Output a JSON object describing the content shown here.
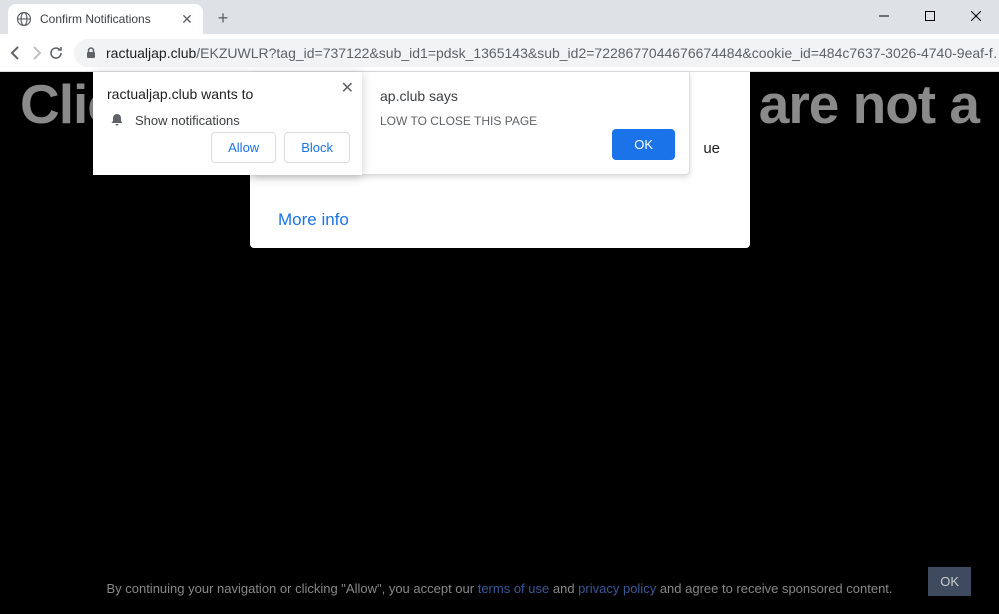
{
  "tab": {
    "title": "Confirm Notifications"
  },
  "url": {
    "domain": "ractualjap.club",
    "path": "/EKZUWLR?tag_id=737122&sub_id1=pdsk_1365143&sub_id2=7228677044676674484&cookie_id=484c7637-3026-4740-9eaf-f…"
  },
  "page": {
    "headline_left": "Clic",
    "headline_right": "u are not a",
    "center_continue": "ue",
    "more_info": "More info"
  },
  "alert": {
    "title_fragment": "ap.club says",
    "message_fragment": "LOW TO CLOSE THIS PAGE",
    "ok": "OK"
  },
  "notif": {
    "title": "ractualjap.club wants to",
    "text": "Show notifications",
    "allow": "Allow",
    "block": "Block"
  },
  "footer": {
    "part1": "By continuing your navigation or clicking \"Allow\", you accept our ",
    "link1": "terms of use",
    "part2": " and ",
    "link2": "privacy policy",
    "part3": " and agree to receive sponsored content.",
    "ok": "OK"
  }
}
